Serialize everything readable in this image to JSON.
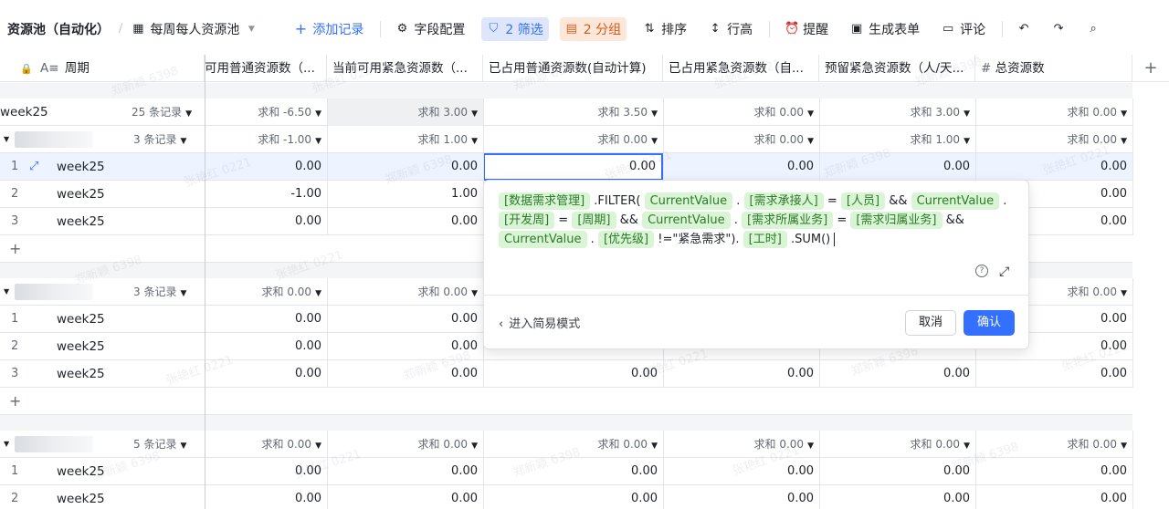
{
  "toolbar": {
    "title": "资源池（自动化）",
    "separator": "/",
    "view_name": "每周每人资源池",
    "add_record": "添加记录",
    "field_config": "字段配置",
    "filter": "2 筛选",
    "group": "2 分组",
    "sort": "排序",
    "row_height": "行高",
    "remind": "提醒",
    "generate_form": "生成表单",
    "comment": "评论"
  },
  "columns": [
    {
      "label": "周期"
    },
    {
      "label": "可用普通资源数（..."
    },
    {
      "label": "当前可用紧急资源数（..."
    },
    {
      "label": "已占用普通资源数(自动计算)"
    },
    {
      "label": "已占用紧急资源数（自..."
    },
    {
      "label": "预留紧急资源数（人/天..."
    },
    {
      "label": "总资源数"
    }
  ],
  "top_group": {
    "name": "week25",
    "count": "25 条记录",
    "aggs": [
      "求和 -6.50",
      "求和 3.00",
      "求和 3.50",
      "求和 0.00",
      "求和 3.00",
      "求和 0.00"
    ]
  },
  "groups": [
    {
      "count": "3 条记录",
      "aggs": [
        "求和 -1.00",
        "求和 1.00",
        "求和 0.00",
        "求和 0.00",
        "求和 1.00",
        "求和 0.00"
      ],
      "rows": [
        {
          "num": "1",
          "week": "week25",
          "v": [
            "0.00",
            "0.00",
            "0.00",
            "0.00",
            "0.00",
            "0.00"
          ]
        },
        {
          "num": "2",
          "week": "week25",
          "v": [
            "-1.00",
            "1.00",
            "",
            "",
            "",
            "0.00"
          ]
        },
        {
          "num": "3",
          "week": "week25",
          "v": [
            "0.00",
            "0.00",
            "",
            "",
            "",
            "0.00"
          ]
        }
      ]
    },
    {
      "count": "3 条记录",
      "aggs": [
        "求和 0.00",
        "求和 0.00",
        "",
        "",
        "",
        "求和 0.00"
      ],
      "rows": [
        {
          "num": "1",
          "week": "week25",
          "v": [
            "0.00",
            "0.00",
            "",
            "",
            "",
            "0.00"
          ]
        },
        {
          "num": "2",
          "week": "week25",
          "v": [
            "0.00",
            "0.00",
            "",
            "",
            "",
            "0.00"
          ]
        },
        {
          "num": "3",
          "week": "week25",
          "v": [
            "0.00",
            "0.00",
            "0.00",
            "0.00",
            "0.00",
            "0.00"
          ]
        }
      ]
    },
    {
      "count": "5 条记录",
      "aggs": [
        "求和 0.00",
        "求和 0.00",
        "求和 0.00",
        "求和 0.00",
        "求和 0.00",
        "求和 0.00"
      ],
      "rows": [
        {
          "num": "1",
          "week": "week25",
          "v": [
            "0.00",
            "0.00",
            "0.00",
            "0.00",
            "0.00",
            "0.00"
          ]
        },
        {
          "num": "2",
          "week": "week25",
          "v": [
            "0.00",
            "0.00",
            "0.00",
            "0.00",
            "0.00",
            "0.00"
          ]
        }
      ]
    }
  ],
  "formula": {
    "tokens": [
      {
        "t": "tok",
        "v": "[数据需求管理]"
      },
      {
        "t": "txt",
        "v": ".FILTER("
      },
      {
        "t": "tok",
        "v": "CurrentValue"
      },
      {
        "t": "txt",
        "v": "."
      },
      {
        "t": "tok",
        "v": "[需求承接人]"
      },
      {
        "t": "txt",
        "v": "="
      },
      {
        "t": "tok",
        "v": "[人员]"
      },
      {
        "t": "txt",
        "v": "&&"
      },
      {
        "t": "tok",
        "v": "CurrentValue"
      },
      {
        "t": "txt",
        "v": "."
      },
      {
        "t": "tok",
        "v": "[开发周]"
      },
      {
        "t": "txt",
        "v": "="
      },
      {
        "t": "tok",
        "v": "[周期]"
      },
      {
        "t": "txt",
        "v": "&&"
      },
      {
        "t": "tok",
        "v": "CurrentValue"
      },
      {
        "t": "txt",
        "v": "."
      },
      {
        "t": "tok",
        "v": "[需求所属业务]"
      },
      {
        "t": "txt",
        "v": "="
      },
      {
        "t": "tok",
        "v": "[需求归属业务]"
      },
      {
        "t": "txt",
        "v": "&&"
      },
      {
        "t": "tok",
        "v": "CurrentValue"
      },
      {
        "t": "txt",
        "v": "."
      },
      {
        "t": "tok",
        "v": "[优先级]"
      },
      {
        "t": "txt",
        "v": "!=\"紧急需求\")."
      },
      {
        "t": "tok",
        "v": "[工时]"
      },
      {
        "t": "txt",
        "v": ".SUM()"
      }
    ],
    "simple_mode": "进入简易模式",
    "cancel": "取消",
    "confirm": "确认",
    "help_icon": "?",
    "expand_icon": "⤢"
  },
  "watermarks": [
    "郑新颖 6398",
    "张艳红 0221"
  ]
}
